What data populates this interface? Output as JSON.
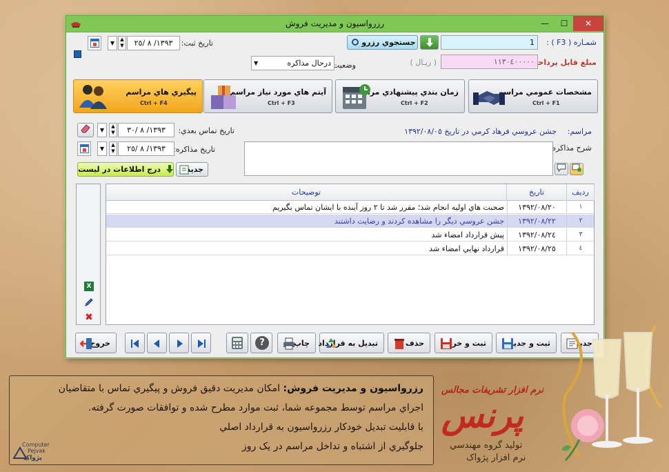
{
  "window": {
    "title": "رزرواسيون و مديريت فروش",
    "controls": [
      "minimize",
      "maximize",
      "close"
    ]
  },
  "header": {
    "number_label": "شمـاره ( F3 ) :",
    "number_value": "1",
    "search_button": "جستجوي رزرو",
    "reg_date_label": "تاريخ ثبت:",
    "reg_date_value": "١٣٩٣/ ٨ /٢٥",
    "amount_label": "مبلغ قابل پرداخت:",
    "amount_value": "١١٣٠٤٠٠٠٠٠",
    "amount_unit": "( ريـال )",
    "status_label": "وضعيت:",
    "status_value": "درحال مذاكره"
  },
  "tabs": [
    {
      "title": "مشخصات عمومي مراسم",
      "shortcut": "Ctrl + F1",
      "icon": "handshake-icon",
      "active": false
    },
    {
      "title": "زمان بندي پيشنهادي مراسم",
      "shortcut": "Ctrl + F2",
      "icon": "calendar-icon",
      "active": false
    },
    {
      "title": "آيتم هاي مورد نياز مراسم",
      "shortcut": "Ctrl + F3",
      "icon": "boxes-icon",
      "active": false
    },
    {
      "title": "پيگيري هاي مراسم",
      "shortcut": "Ctrl + F4",
      "icon": "people-icon",
      "active": true
    }
  ],
  "followup": {
    "ceremony_label": "مراسم:",
    "ceremony_value": "جشن عروسي فرهاد كرمي در تاريخ ١٣٩٢/٠٨/٠٥",
    "next_contact_label": "تاريخ تماس بعدي:",
    "next_contact_value": "١٣٩٣/ ٨ /٣٠",
    "negotiation_date_label": "تاريخ مذاكره:",
    "negotiation_date_value": "١٣٩٣/ ٨ /٢٥",
    "description_label": "شرح مذاكره:",
    "new_button": "جديد",
    "insert_button": "درج اطلاعات در ليست"
  },
  "grid": {
    "columns": [
      "رديف",
      "تاريخ",
      "توضيحات"
    ],
    "rows": [
      {
        "idx": "١",
        "date": "١٣٩٢/٠٨/٢٠",
        "desc": "صحبت هاي اوليه انجام شد؛ مقرر شد تا ٢ روز آينده با ايشان تماس بگيريم",
        "selected": false
      },
      {
        "idx": "٢",
        "date": "١٣٩٢/٠٨/٢٢",
        "desc": "جشن عروسي ديگر را مشاهده كردند و رضايت داشتند",
        "selected": true
      },
      {
        "idx": "٣",
        "date": "١٣٩٢/٠٨/٢٤",
        "desc": "پيش قرارداد امضاء شد",
        "selected": false
      },
      {
        "idx": "٤",
        "date": "١٣٩٢/٠٨/٢٥",
        "desc": "قرارداد نهايي امضاء شد",
        "selected": false
      }
    ]
  },
  "toolbar": {
    "new": "جديد",
    "save_new": "ثبت و جديد",
    "save_exit": "ثبت و خروج",
    "delete": "حذف",
    "convert": "تبديل به قرارداد",
    "print": "چاپ",
    "exit": "خروج"
  },
  "caption": {
    "bold_lead": "رزرواسيون و مديريت فروش:",
    "line1": "امكان مديريت دقيق فروش و پيگيري تماس با متقاضيان",
    "line2": "اجراي مراسم توسط مجموعه شما، ثبت موارد مطرح شده و توافقات صورت گرفته.",
    "line3": "با قابليت تبديل خودكار رزرواسيون به قرارداد اصلي",
    "line4": "جلوگيري از اشتباه و تداخل مراسم در يک روز"
  },
  "branding": {
    "tagline": "نرم افزار تشريفات مجالس",
    "product": "پرنس",
    "producer1": "توليد گروه مهندسي",
    "producer2": "نرم افزار پژواک",
    "logo_text1": "Computer",
    "logo_text2": "Pejvak",
    "logo_text3": "پژواک"
  },
  "colors": {
    "titlebar": "#80c855",
    "active_tab": "#f1a51f",
    "selected_row": "#d4d8f0",
    "brand_red": "#c0362c"
  }
}
